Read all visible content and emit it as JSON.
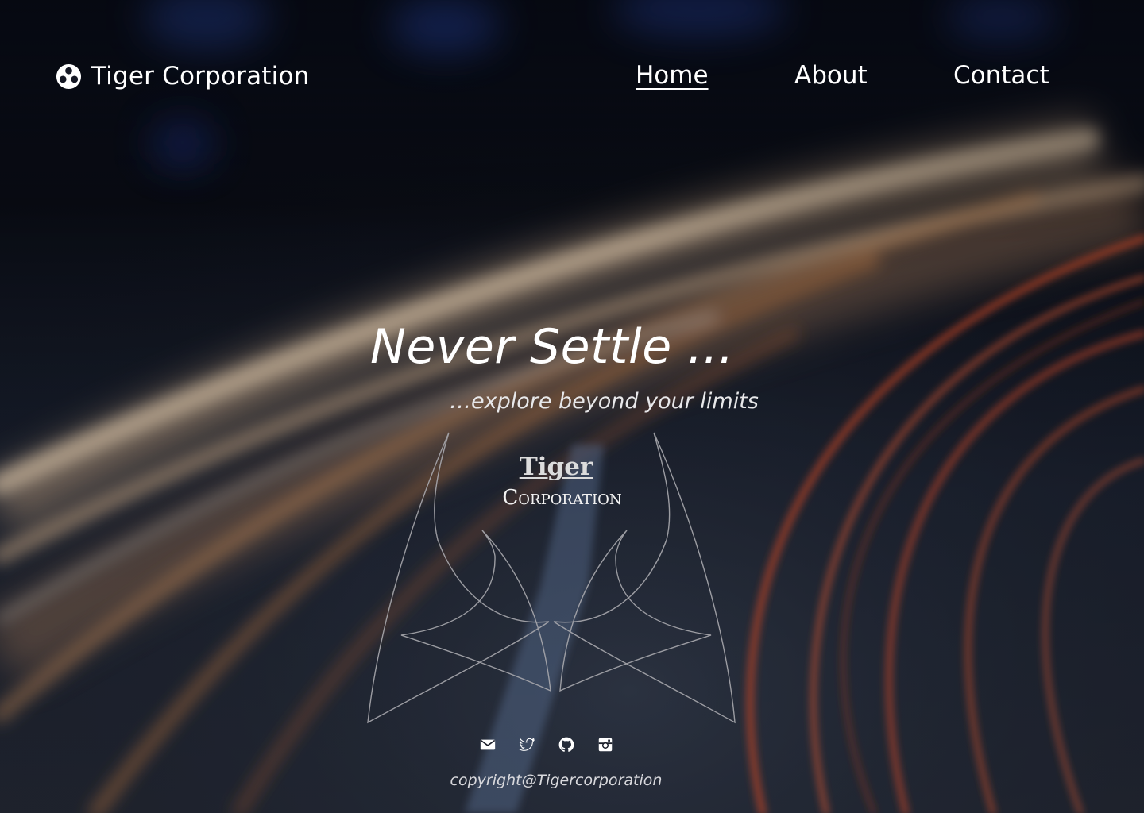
{
  "colors": {
    "background": "#0b0e16",
    "text": "#ffffff",
    "trail_warm": "#d9a77a",
    "trail_red": "#c8442a",
    "emblem_stroke": "#a9a9ae"
  },
  "header": {
    "brand_icon": "dots-circle-icon",
    "brand_name": "Tiger Corporation",
    "nav": [
      {
        "label": "Home",
        "active": true
      },
      {
        "label": "About",
        "active": false
      },
      {
        "label": "Contact",
        "active": false
      }
    ]
  },
  "hero": {
    "title": "Never Settle ...",
    "subtitle": "…explore beyond your limits"
  },
  "logo": {
    "line1": "Tiger",
    "line2": "Corporation"
  },
  "footer": {
    "socials": [
      {
        "icon": "mail-icon"
      },
      {
        "icon": "twitter-icon"
      },
      {
        "icon": "github-icon"
      },
      {
        "icon": "instagram-icon"
      }
    ],
    "copyright": "copyright@Tigercorporation"
  }
}
